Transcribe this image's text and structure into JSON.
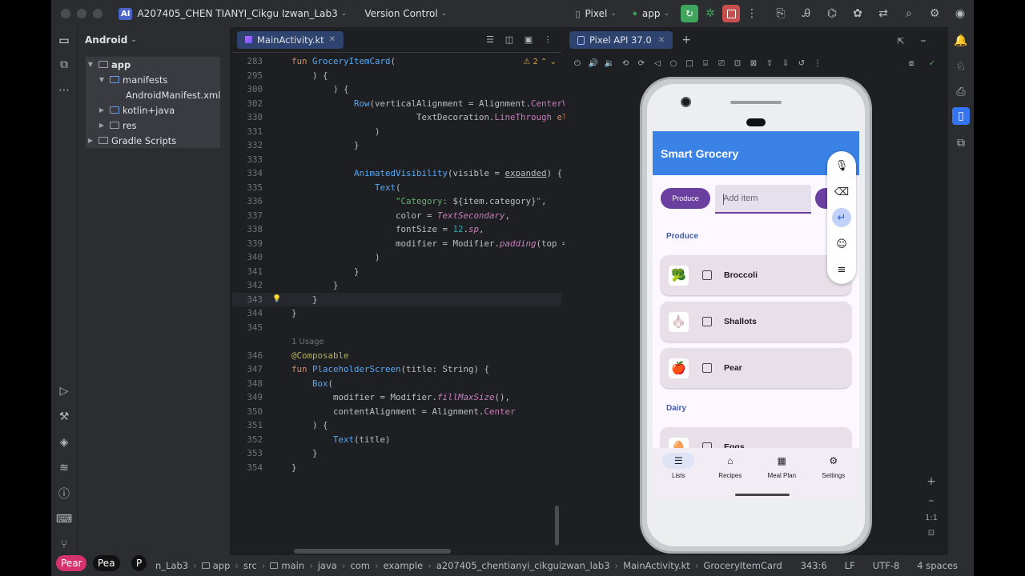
{
  "titlebar": {
    "project_badge": "AI",
    "project_name": "A207405_CHEN TIANYI_Cikgu Izwan_Lab3",
    "vcs_label": "Version Control",
    "device_label": "Pixel",
    "run_config": "app"
  },
  "project_panel": {
    "title": "Android",
    "tree": [
      {
        "label": "app",
        "level": 0,
        "expanded": true,
        "bold": true
      },
      {
        "label": "manifests",
        "level": 1,
        "expanded": true
      },
      {
        "label": "AndroidManifest.xml",
        "level": 2
      },
      {
        "label": "kotlin+java",
        "level": 1,
        "expanded": false
      },
      {
        "label": "res",
        "level": 1,
        "expanded": false
      },
      {
        "label": "Gradle Scripts",
        "level": 0,
        "expanded": false
      }
    ]
  },
  "editor": {
    "tab_label": "MainActivity.kt",
    "warning_count": "2",
    "lines": [
      {
        "n": "283",
        "html": "<span class='kw'>fun </span><span class='fn'>GroceryItemCard</span><span class='tx'>(</span>"
      },
      {
        "n": "295",
        "html": "<span class='tx'>    ) {</span>"
      },
      {
        "n": "300",
        "html": "<span class='tx'>        ) {</span>"
      },
      {
        "n": "302",
        "html": "<span class='tx'>            </span><span class='fn'>Row</span><span class='tx'>(verticalAlignment = Alignment.</span><span class='prop'>CenterVe</span>"
      },
      {
        "n": "330",
        "html": "<span class='tx'>                        TextDecoration.</span><span class='prop'>LineThrough</span><span class='kw'> els</span>"
      },
      {
        "n": "331",
        "html": "<span class='tx'>                )</span>"
      },
      {
        "n": "332",
        "html": "<span class='tx'>            }</span>"
      },
      {
        "n": "333",
        "html": ""
      },
      {
        "n": "334",
        "html": "<span class='tx'>            </span><span class='fn'>AnimatedVisibility</span><span class='tx'>(visible = <u>expanded</u>) {</span>"
      },
      {
        "n": "335",
        "html": "<span class='tx'>                </span><span class='fn'>Text</span><span class='tx'>(</span>"
      },
      {
        "n": "336",
        "html": "<span class='str'>                    \"Category: </span><span class='tx'>${item.category}</span><span class='str'>\"</span><span class='tx'>,</span>"
      },
      {
        "n": "337",
        "html": "<span class='tx'>                    color = </span><span class='it'>TextSecondary</span><span class='tx'>,</span>"
      },
      {
        "n": "338",
        "html": "<span class='tx'>                    fontSize = </span><span class='num'>12</span><span class='tx'>.</span><span class='it'>sp</span><span class='tx'>,</span>"
      },
      {
        "n": "339",
        "html": "<span class='tx'>                    modifier = Modifier.</span><span class='it'>padding</span><span class='tx'>(top =</span>"
      },
      {
        "n": "340",
        "html": "<span class='tx'>                )</span>"
      },
      {
        "n": "341",
        "html": "<span class='tx'>            }</span>"
      },
      {
        "n": "342",
        "html": "<span class='tx'>        }</span>"
      },
      {
        "n": "343",
        "html": "<span class='tx'>    }</span>",
        "current": true
      },
      {
        "n": "344",
        "html": "<span class='tx'>}</span>"
      },
      {
        "n": "345",
        "html": ""
      },
      {
        "n": "",
        "html": "<span class='usage'>1 Usage</span>"
      },
      {
        "n": "346",
        "html": "<span class='ann'>@Composable</span>"
      },
      {
        "n": "347",
        "html": "<span class='kw'>fun </span><span class='fn'>PlaceholderScreen</span><span class='tx'>(title: String) {</span>"
      },
      {
        "n": "348",
        "html": "<span class='tx'>    </span><span class='fn'>Box</span><span class='tx'>(</span>"
      },
      {
        "n": "349",
        "html": "<span class='tx'>        modifier = Modifier.</span><span class='it'>fillMaxSize</span><span class='tx'>(),</span>"
      },
      {
        "n": "350",
        "html": "<span class='tx'>        contentAlignment = Alignment.</span><span class='prop'>Center</span>"
      },
      {
        "n": "351",
        "html": "<span class='tx'>    ) {</span>"
      },
      {
        "n": "352",
        "html": "<span class='tx'>        </span><span class='fn'>Text</span><span class='tx'>(title)</span>"
      },
      {
        "n": "353",
        "html": "<span class='tx'>    }</span>"
      },
      {
        "n": "354",
        "html": "<span class='tx'>}</span>"
      }
    ]
  },
  "devices": {
    "tab_label": "Pixel API 37.0"
  },
  "app": {
    "title": "Smart Grocery",
    "chip_label": "Produce",
    "input_placeholder": "Add item",
    "sections": [
      {
        "title": "Produce",
        "items": [
          {
            "name": "Broccoli",
            "emoji": "🥦"
          },
          {
            "name": "Shallots",
            "emoji": "🧄"
          },
          {
            "name": "Pear",
            "emoji": "🍎"
          }
        ]
      },
      {
        "title": "Dairy",
        "items": [
          {
            "name": "Eggs",
            "emoji": "🥚"
          }
        ]
      }
    ],
    "nav": [
      {
        "label": "Lists",
        "icon": "☰",
        "selected": true
      },
      {
        "label": "Recipes",
        "icon": "⌂"
      },
      {
        "label": "Meal Plan",
        "icon": "▦"
      },
      {
        "label": "Settings",
        "icon": "⚙"
      }
    ]
  },
  "statusbar": {
    "crumbs": [
      "n_Lab3",
      "app",
      "src",
      "main",
      "java",
      "com",
      "example",
      "a207405_chentianyi_cikguizwan_lab3",
      "MainActivity.kt",
      "GroceryItemCard"
    ],
    "position": "343:6",
    "line_sep": "LF",
    "encoding": "UTF-8",
    "indent": "4 spaces"
  },
  "overlay": {
    "chip1": "Pear",
    "chip2": "Pea",
    "chip3": "P"
  },
  "zoom": {
    "reset": "1:1"
  }
}
